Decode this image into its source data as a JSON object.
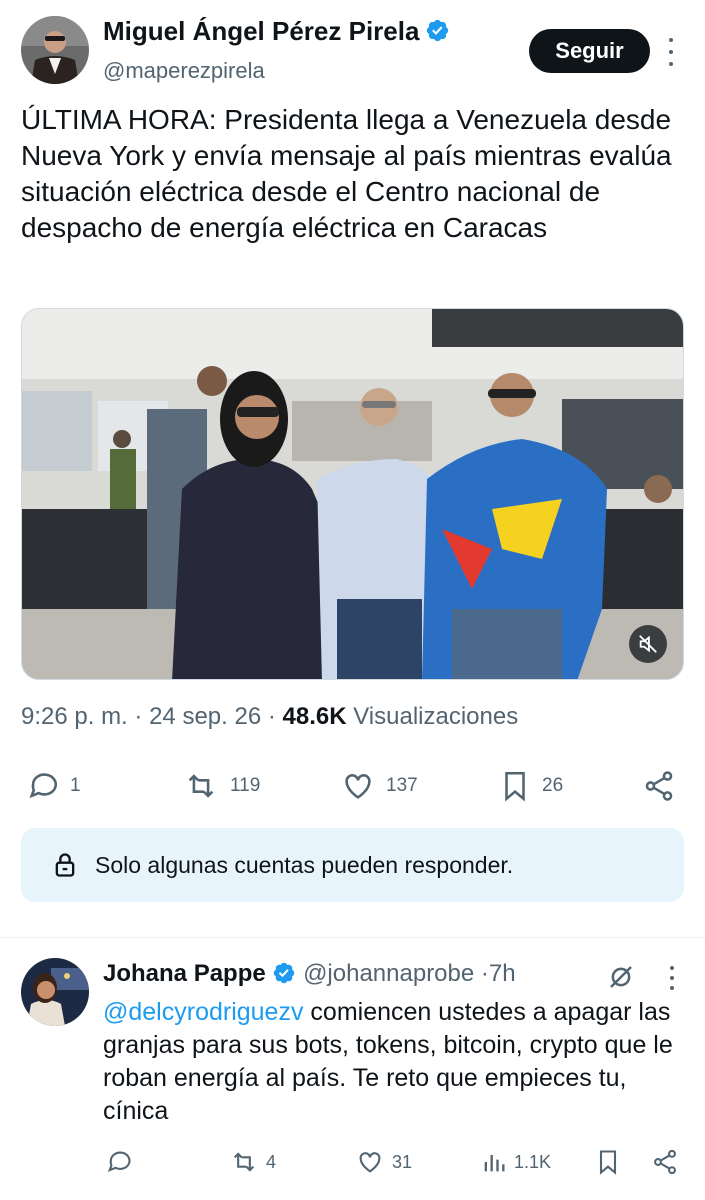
{
  "post": {
    "author_name": "Miguel Ángel Pérez Pirela",
    "author_handle": "@maperezpirela",
    "follow_label": "Seguir",
    "text": "ÚLTIMA HORA: Presidenta llega a Venezuela desde Nueva York y envía mensaje al país mientras evalúa situación eléctrica desde el Centro nacional de despacho de energía eléctrica en Caracas",
    "time": "9:26 p. m.",
    "date": "24 sep. 26",
    "views_count": "48.6K",
    "views_label": "Visualizaciones",
    "stats": {
      "replies": "1",
      "reposts": "119",
      "likes": "137",
      "bookmarks": "26"
    },
    "reply_restriction": "Solo algunas cuentas pueden responder."
  },
  "reply": {
    "author_name": "Johana Pappe",
    "author_handle": "@johannaprobe",
    "time": "7h",
    "mention": "@delcyrodriguezv",
    "text": "comiencen ustedes a apagar las granjas para sus bots, tokens, bitcoin, crypto que le roban energía al país. Te reto que empieces tu, cínica",
    "stats": {
      "reposts": "4",
      "likes": "31",
      "views": "1.1K"
    }
  },
  "colors": {
    "accent": "#1d9bf0",
    "muted": "#536471",
    "text": "#0f1419",
    "restricted_bg": "#e8f4fb"
  }
}
